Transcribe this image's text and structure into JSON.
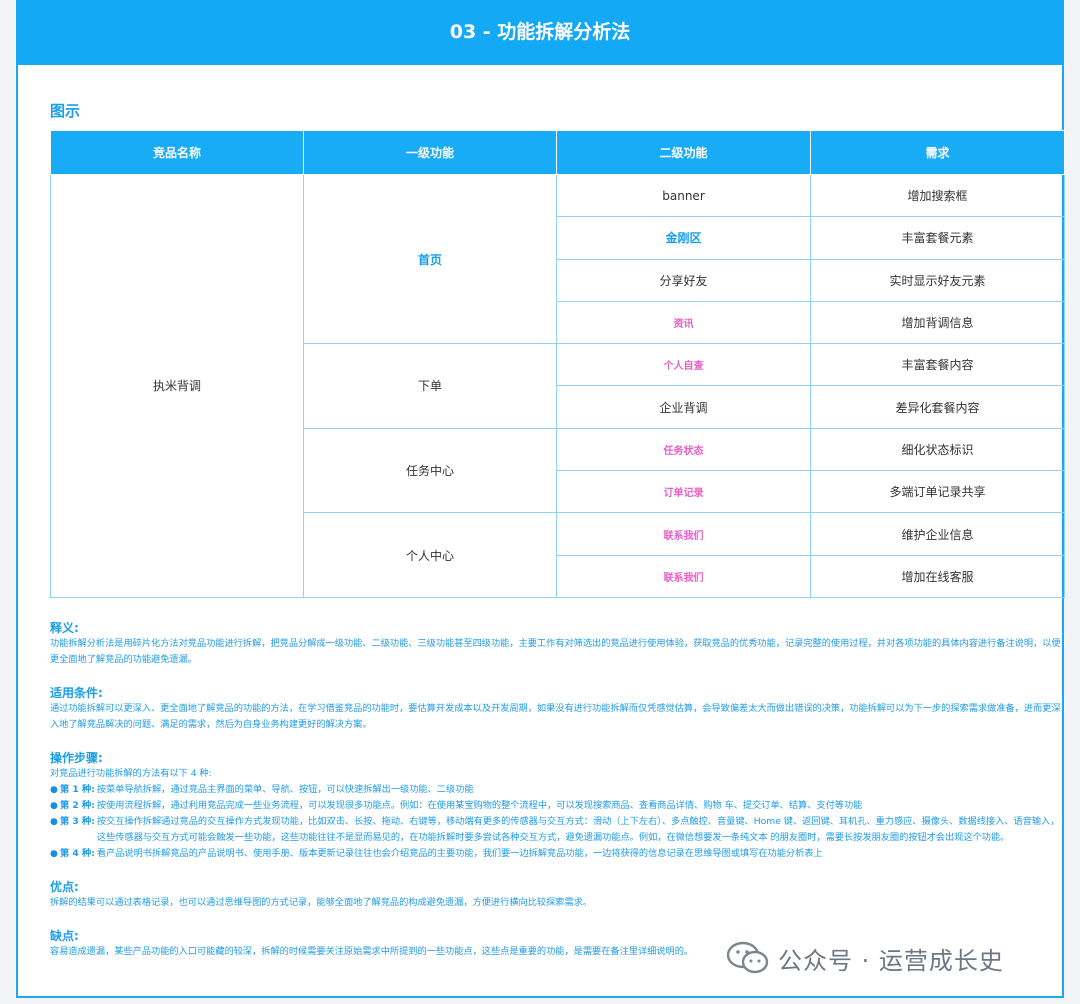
{
  "header": {
    "title": "03 - 功能拆解分析法"
  },
  "section": {
    "label": "图示"
  },
  "table": {
    "columns": [
      "竞品名称",
      "一级功能",
      "二级功能",
      "需求"
    ],
    "product": "执米背调",
    "groups": [
      {
        "name": "首页",
        "rows": [
          {
            "sub": "banner",
            "need": "增加搜索框"
          },
          {
            "sub": "金刚区",
            "need": "丰富套餐元素"
          },
          {
            "sub": "分享好友",
            "need": "实时显示好友元素"
          },
          {
            "sub": "资讯",
            "need": "增加背调信息"
          }
        ]
      },
      {
        "name": "下单",
        "rows": [
          {
            "sub": "个人自查",
            "need": "丰富套餐内容"
          },
          {
            "sub": "企业背调",
            "need": "差异化套餐内容"
          }
        ]
      },
      {
        "name": "任务中心",
        "rows": [
          {
            "sub": "任务状态",
            "need": "细化状态标识"
          },
          {
            "sub": "订单记录",
            "need": "多端订单记录共享"
          }
        ]
      },
      {
        "name": "个人中心",
        "rows": [
          {
            "sub": "联系我们",
            "need": "维护企业信息"
          },
          {
            "sub": "联系我们",
            "need": "增加在线客服"
          }
        ]
      }
    ]
  },
  "notes": {
    "definition_title": "释义:",
    "definition_text": "功能拆解分析法是用碎片化方法对竞品功能进行拆解，把竞品分解成一级功能、二级功能、三级功能甚至四级功能，主要工作有对筛选出的竞品进行使用体验，获取竞品的优秀功能，记录完整的使用过程，并对各项功能的具体内容进行备注说明，以便更全面地了解竞品的功能避免遗漏。",
    "conditions_title": "适用条件:",
    "conditions_text": "通过功能拆解可以更深入、更全面地了解竞品的功能的方法，在学习借鉴竞品的功能时，要估算开发成本以及开发周期，如果没有进行功能拆解而仅凭感觉估算，会导致偏差太大而做出错误的决策，功能拆解可以为下一步的探索需求做准备，进而更深入地了解竞品解决的问题、满足的需求，然后为自身业务构建更好的解决方案。",
    "steps_title": "操作步骤:",
    "steps_intro": "对竞品进行功能拆解的方法有以下 4 种:",
    "steps": [
      {
        "lead": "第 1 种:",
        "text": "按菜单导航拆解，通过竞品主界面的菜单、导航、按钮，可以快速拆解出一级功能、二级功能"
      },
      {
        "lead": "第 2 种:",
        "text": "按使用流程拆解，通过利用竞品完成一些业务流程，可以发现很多功能点。例如：在使用某宝购物的整个流程中，可以发现搜索商品、查看商品详情、购物 车、提交订单、结算、支付等功能"
      },
      {
        "lead": "第 3 种:",
        "text": "按交互操作拆解通过竞品的交互操作方式发现功能，比如双击、长按、拖动、右键等，移动端有更多的传感器与交互方式：滑动（上下左右）、多点触控、音量键、Home 键、返回键、耳机孔、重力感应、摄像头、数据线接入、语音输入，这些传感器与交互方式可能会触发一些功能，这些功能往往不是显而易见的，在功能拆解时要多尝试各种交互方式，避免遗漏功能点。例如，在微信想要发一条纯文本 的朋友圈时，需要长按发朋友圈的按钮才会出现这个功能。"
      },
      {
        "lead": "第 4 种:",
        "text": "看产品说明书拆解竞品的产品说明书、使用手册、版本更新记录往往也会介绍竞品的主要功能，我们要一边拆解竞品功能，一边将获得的信息记录在思维导图或填写在功能分析表上"
      }
    ],
    "pros_title": "优点:",
    "pros_text": "拆解的结果可以通过表格记录，也可以通过思维导图的方式记录，能够全面地了解竞品的构成避免遗漏，方便进行横向比较探索需求。",
    "cons_title": "缺点:",
    "cons_text": "容易造成遗漏，某些产品功能的入口可能藏的较深，拆解的时候需要关注原始需求中所提到的一些功能点，这些点是重要的功能，是需要在备注里详细说明的。"
  },
  "watermark": {
    "text": "公众号 · 运营成长史"
  },
  "colors": {
    "accent": "#14a9f5",
    "highlight_pink": "#e85fc6",
    "text_blue": "#1a9ee8"
  }
}
